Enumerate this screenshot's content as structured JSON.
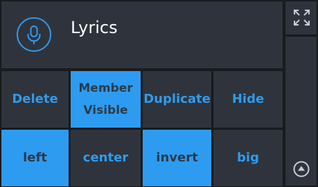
{
  "header": {
    "title": "Lyrics",
    "icon": "microphone-icon"
  },
  "side": {
    "top_icon": "fullscreen-icon",
    "bottom_icon": "scroll-up-icon"
  },
  "buttons_row1": [
    {
      "label": "Delete",
      "active": false
    },
    {
      "label_line1": "Member",
      "label_line2": "Visible",
      "active": true
    },
    {
      "label": "Duplicate",
      "active": false
    },
    {
      "label": "Hide",
      "active": false
    }
  ],
  "buttons_row2": [
    {
      "label": "left",
      "active": true
    },
    {
      "label": "center",
      "active": false
    },
    {
      "label": "invert",
      "active": true
    },
    {
      "label": "big",
      "active": false
    }
  ],
  "colors": {
    "accent": "#2d9cf0",
    "panel": "#2f343c",
    "background": "#1b1e22",
    "active_text": "#2c3a4a"
  }
}
